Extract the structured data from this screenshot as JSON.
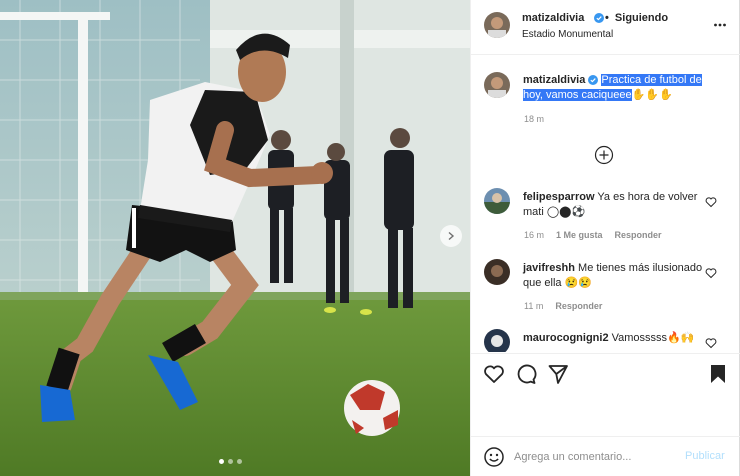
{
  "post": {
    "username": "matizaldivia",
    "follow_label": "Siguiendo",
    "separator": "•",
    "location": "Estadio Monumental",
    "caption_highlighted": "Practica de futbol de hoy, vamos caciqueee",
    "caption_emoji": "✋✋✋",
    "caption_time": "18 m",
    "image_dots": 3,
    "active_dot": 0
  },
  "comments": [
    {
      "username": "felipesparrow",
      "text": "Ya es hora de volver mati",
      "emoji": "◯⬤⚽",
      "time": "16 m",
      "likes": "1 Me gusta",
      "reply": "Responder"
    },
    {
      "username": "javifreshh",
      "text": "Me tienes más ilusionado que ella",
      "emoji": "😢😢",
      "time": "11 m",
      "likes": "",
      "reply": "Responder"
    },
    {
      "username": "maurocognigni2",
      "text": "Vamosssss",
      "emoji": "🔥🙌",
      "time": "",
      "likes": "",
      "reply": ""
    }
  ],
  "add_comment": {
    "placeholder": "Agrega un comentario...",
    "publish_label": "Publicar"
  },
  "icons": {
    "more": "more-options-icon",
    "like": "heart-icon",
    "comment": "comment-icon",
    "share": "paper-plane-icon",
    "save": "bookmark-icon",
    "emoji": "smiley-icon",
    "next": "chevron-right-icon",
    "load_more": "plus-circle-icon",
    "verified": "verified-badge-icon"
  },
  "colors": {
    "verified": "#3897f0",
    "highlight": "#3478f6",
    "publish_disabled": "#b2dffc",
    "muted_text": "#8e8e8e"
  }
}
